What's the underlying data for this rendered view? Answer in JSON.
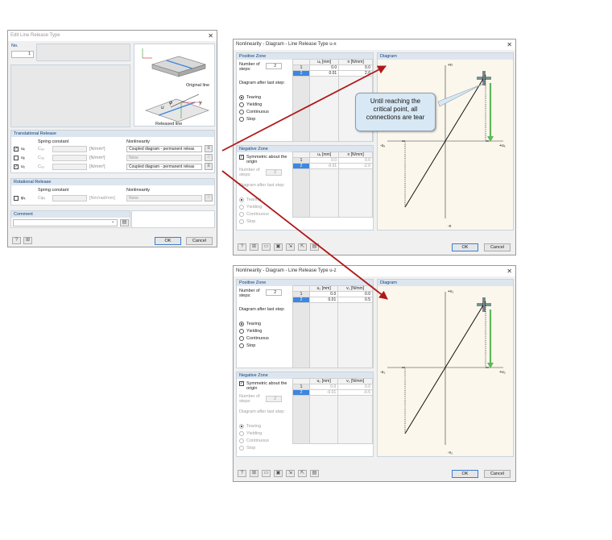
{
  "edit_dialog": {
    "title": "Edit Line Release Type",
    "no_label": "No.",
    "no_value": "1",
    "image_labels": {
      "original_line": "Original line",
      "released_line": "Released line"
    },
    "trans_header": "Translational Release",
    "spring_constant_label": "Spring constant",
    "nonlinearity_label": "Nonlinearity",
    "trans_rows": [
      {
        "checked": true,
        "dof": "uₓ",
        "constant": "Cᵤₓ",
        "unit": "[N/mm²]",
        "nonlinearity": "Coupled diagram - permanent releas",
        "enabled": true
      },
      {
        "checked": false,
        "dof": "uᵧ",
        "constant": "Cᵤᵧ",
        "unit": "[N/mm²]",
        "nonlinearity": "None",
        "enabled": false
      },
      {
        "checked": true,
        "dof": "u₂",
        "constant": "Cᵤ₂",
        "unit": "[N/mm²]",
        "nonlinearity": "Coupled diagram - permanent releas",
        "enabled": true
      }
    ],
    "rot_header": "Rotational Release",
    "rot_row": {
      "checked": false,
      "dof": "φₓ",
      "constant": "Cφₓ",
      "unit": "[Nm/rad/mm]",
      "nonlinearity": "None"
    },
    "comment_header": "Comment",
    "ok": "OK",
    "cancel": "Cancel"
  },
  "dialog_x": {
    "title": "Nonlinearity - Diagram - Line Release Type u-x",
    "positive_zone": "Positive Zone",
    "num_steps_label": "Number of steps:",
    "num_steps": "2",
    "col_u": "uₓ [mm]",
    "col_f": "n [N/mm]",
    "pos_rows": [
      {
        "n": "1",
        "u": "0.0",
        "f": "0.0"
      },
      {
        "n": "2",
        "u": "0.01",
        "f": "2.0"
      }
    ],
    "after_label": "Diagram after last step:",
    "options": [
      "Tearing",
      "Yielding",
      "Continuous",
      "Stop"
    ],
    "negative_zone": "Negative Zone",
    "symmetric_label": "Symmetric about the origin",
    "neg_num_steps": "2",
    "neg_rows": [
      {
        "n": "1",
        "u": "0.0",
        "f": "0.0"
      },
      {
        "n": "2",
        "u": "-0.01",
        "f": "-2.0"
      }
    ],
    "diagram_header": "Diagram",
    "axis_top": "+n",
    "axis_bottom": "-n",
    "axis_left": "-uₓ",
    "axis_right": "+uₓ",
    "ok": "OK",
    "cancel": "Cancel"
  },
  "dialog_z": {
    "title": "Nonlinearity - Diagram - Line Release Type u-z",
    "positive_zone": "Positive Zone",
    "num_steps_label": "Number of steps:",
    "num_steps": "2",
    "col_u": "u₂ [mm]",
    "col_f": "v₂ [N/mm]",
    "pos_rows": [
      {
        "n": "1",
        "u": "0.0",
        "f": "0.0"
      },
      {
        "n": "2",
        "u": "0.01",
        "f": "0.5"
      }
    ],
    "after_label": "Diagram after last step:",
    "options": [
      "Tearing",
      "Yielding",
      "Continuous",
      "Stop"
    ],
    "negative_zone": "Negative Zone",
    "symmetric_label": "Symmetric about the origin",
    "neg_num_steps": "2",
    "neg_rows": [
      {
        "n": "1",
        "u": "0.0",
        "f": "0.0"
      },
      {
        "n": "2",
        "u": "-0.01",
        "f": "-0.5"
      }
    ],
    "diagram_header": "Diagram",
    "axis_top": "+v₂",
    "axis_bottom": "-v₂",
    "axis_left": "-u₂",
    "axis_right": "+u₂",
    "ok": "OK",
    "cancel": "Cancel"
  },
  "callout_text": "Until reaching the critical point, all connections are tear",
  "colors": {
    "arrow": "#b01818",
    "accent": "#3e86de",
    "panel_header": "#dde6ef",
    "green_arrow": "#5cb85c"
  }
}
